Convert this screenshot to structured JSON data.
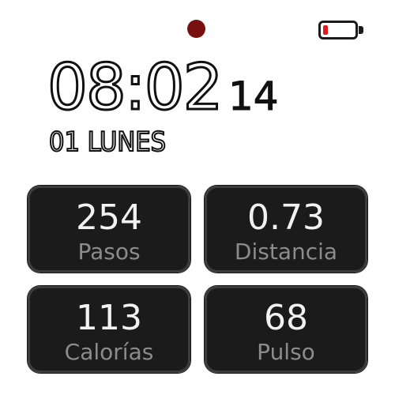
{
  "status": {
    "record_indicator_color": "#7a0f0f",
    "record_icon": "record-dot-icon",
    "battery_icon": "battery-low-icon",
    "battery_level": 0.15,
    "battery_fill_color": "#e01b1b"
  },
  "clock": {
    "time": "08:02",
    "seconds": "14",
    "date": "01 LUNES"
  },
  "stats": [
    {
      "value": "254",
      "label": "Pasos"
    },
    {
      "value": "0.73",
      "label": "Distancia"
    },
    {
      "value": "113",
      "label": "Calorías"
    },
    {
      "value": "68",
      "label": "Pulso"
    }
  ],
  "colors": {
    "tile_background": "#1b1b1b",
    "tile_border": "#3c3c3c",
    "value_text": "#f2f2f2",
    "label_text": "#8c8c8c"
  }
}
